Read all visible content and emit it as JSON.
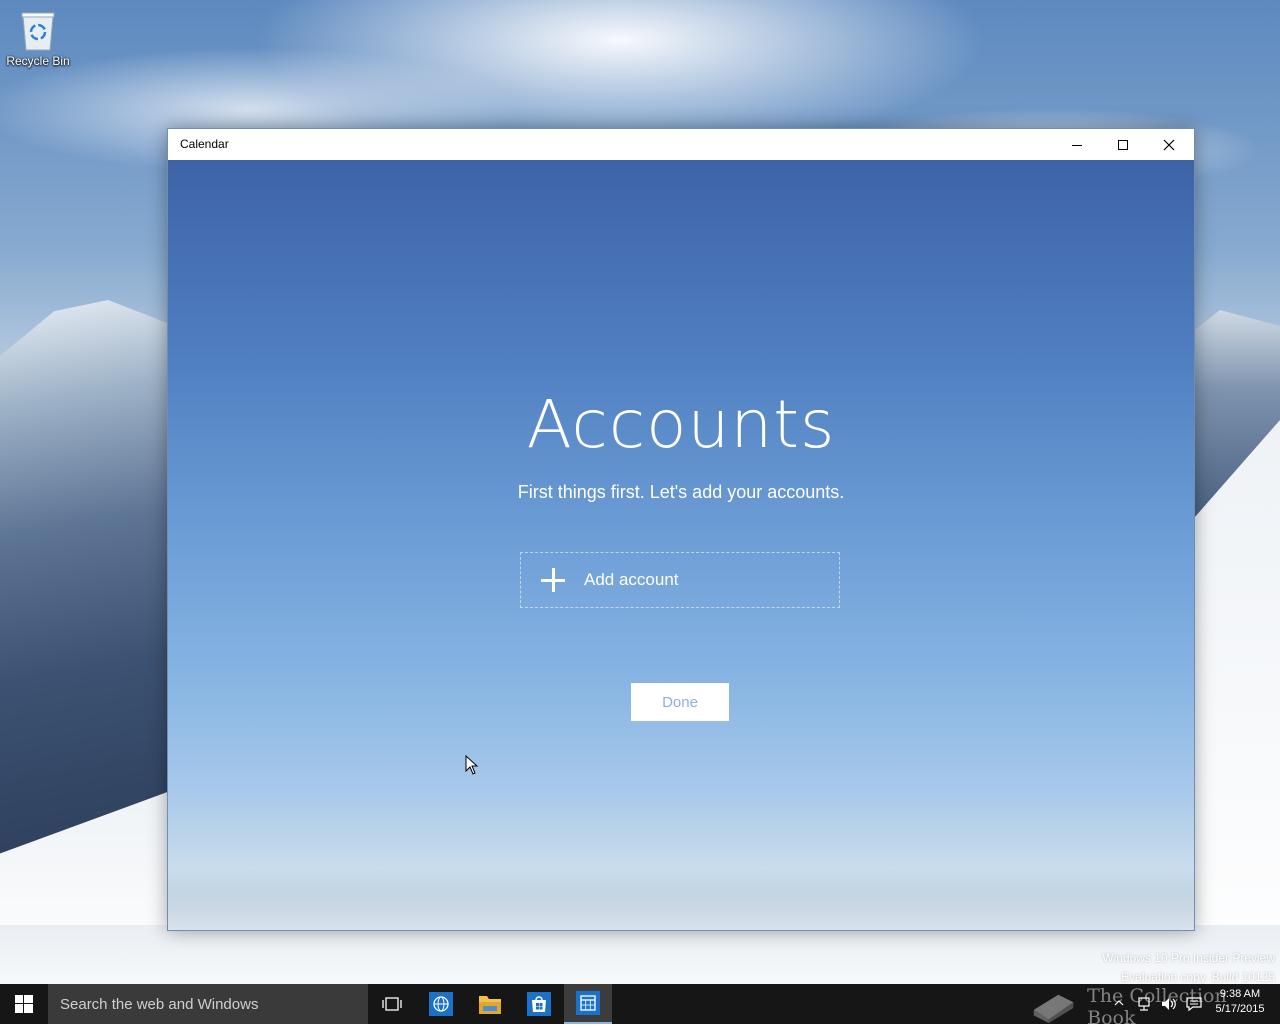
{
  "desktop": {
    "icons": [
      {
        "label": "Recycle Bin",
        "icon": "recycle-bin-icon"
      }
    ],
    "watermark": {
      "line1": "Windows 10 Pro Insider Preview",
      "line2": "Evaluation copy. Build 10125"
    }
  },
  "window": {
    "title": "Calendar",
    "controls": {
      "minimize": "minimize-icon",
      "maximize": "maximize-icon",
      "close": "close-icon"
    },
    "content": {
      "heading": "Accounts",
      "subheading": "First things first. Let's add your accounts.",
      "add_account_label": "Add account",
      "done_label": "Done"
    }
  },
  "taskbar": {
    "search_placeholder": "Search the web and Windows",
    "pinned": [
      {
        "name": "task-view",
        "icon": "task-view-icon"
      },
      {
        "name": "browser",
        "icon": "globe-icon"
      },
      {
        "name": "file-explorer",
        "icon": "folder-icon"
      },
      {
        "name": "store",
        "icon": "store-bag-icon"
      },
      {
        "name": "calendar",
        "icon": "calendar-icon",
        "active": true
      }
    ],
    "tray": {
      "time": "9:38 AM",
      "date": "5/17/2015",
      "watermark_brand": "The Collection Book"
    }
  },
  "colors": {
    "taskbar": "#161616",
    "search_box": "#3a3a3a",
    "done_text": "#8fb0d6",
    "accent_underline": "#8fb3e0"
  }
}
